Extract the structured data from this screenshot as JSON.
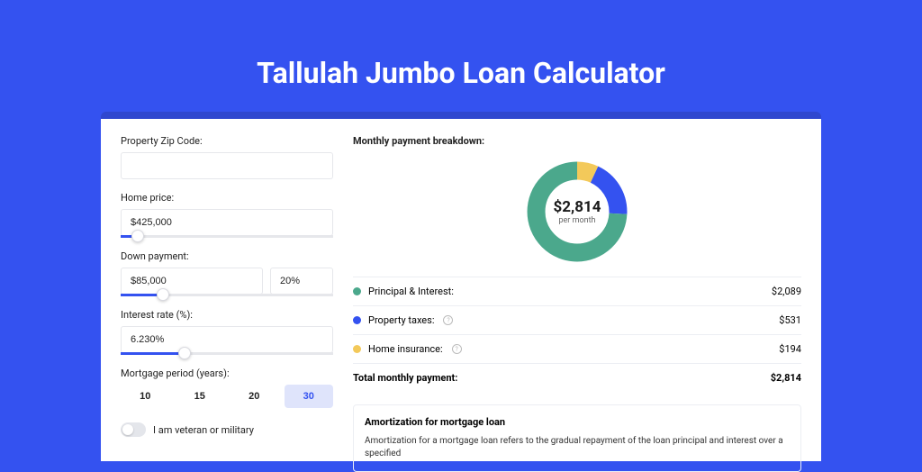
{
  "title": "Tallulah Jumbo Loan Calculator",
  "left": {
    "zip_label": "Property Zip Code:",
    "zip_value": "",
    "home_price_label": "Home price:",
    "home_price_value": "$425,000",
    "home_price_slider_pct": 8,
    "down_payment_label": "Down payment:",
    "down_payment_value": "$85,000",
    "down_payment_pct_value": "20%",
    "down_payment_slider_pct": 20,
    "interest_label": "Interest rate (%):",
    "interest_value": "6.230%",
    "interest_slider_pct": 30,
    "period_label": "Mortgage period (years):",
    "periods": [
      "10",
      "15",
      "20",
      "30"
    ],
    "period_active": "30",
    "veteran_label": "I am veteran or military"
  },
  "breakdown": {
    "title": "Monthly payment breakdown:",
    "total_value": "$2,814",
    "total_sub": "per month",
    "rows": [
      {
        "color": "green",
        "label": "Principal & Interest:",
        "info": false,
        "value": "$2,089"
      },
      {
        "color": "blue",
        "label": "Property taxes:",
        "info": true,
        "value": "$531"
      },
      {
        "color": "yellow",
        "label": "Home insurance:",
        "info": true,
        "value": "$194"
      }
    ],
    "total_row_label": "Total monthly payment:",
    "total_row_value": "$2,814"
  },
  "amort": {
    "title": "Amortization for mortgage loan",
    "text": "Amortization for a mortgage loan refers to the gradual repayment of the loan principal and interest over a specified"
  },
  "chart_data": {
    "type": "pie",
    "title": "Monthly payment breakdown",
    "series": [
      {
        "name": "Principal & Interest",
        "value": 2089,
        "color": "#4ba88c"
      },
      {
        "name": "Property taxes",
        "value": 531,
        "color": "#3452f0"
      },
      {
        "name": "Home insurance",
        "value": 194,
        "color": "#f3c95a"
      }
    ],
    "total": 2814
  }
}
